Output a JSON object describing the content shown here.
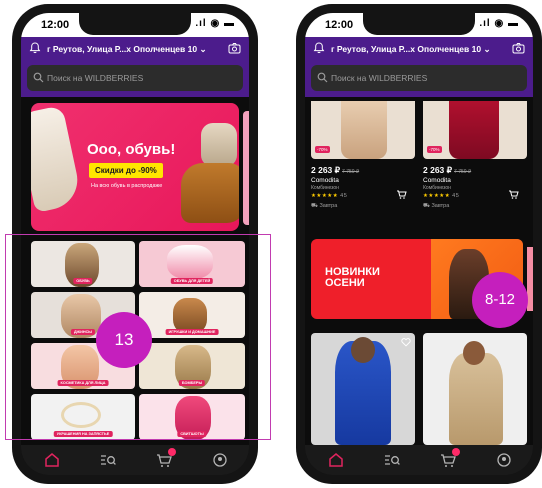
{
  "status": {
    "time": "12:00"
  },
  "header": {
    "address": "г Реутов, Улица Р...х Ополченцев 10"
  },
  "search": {
    "placeholder": "Поиск на WILDBERRIES"
  },
  "banner_shoes": {
    "title": "Ооо, обувь!",
    "badge": "Скидки до -90%",
    "subtitle": "На всю обувь в распродаже"
  },
  "categories": [
    {
      "label": "ОБУВЬ"
    },
    {
      "label": "ОБУВЬ ДЛЯ ДЕТЕЙ"
    },
    {
      "label": "ДЖИНСЫ"
    },
    {
      "label": "ИГРУШКИ И ДОМАШНИЕ"
    },
    {
      "label": "КОСМЕТИКА ДЛЯ ЛИЦА"
    },
    {
      "label": "БОМБЕРЫ"
    },
    {
      "label": "УКРАШЕНИЯ НА ЗАПЯСТЬЕ"
    },
    {
      "label": "СВИТШОТЫ"
    }
  ],
  "products": [
    {
      "price": "2 263 ₽",
      "old_price": "7 750 ₽",
      "discount": "-70%",
      "brand": "Comodita",
      "kind": "Комбинезон",
      "stars": "★★★★★",
      "reviews": "45",
      "delivery": "Завтра"
    },
    {
      "price": "2 263 ₽",
      "old_price": "7 750 ₽",
      "discount": "-70%",
      "brand": "Comodita",
      "kind": "Комбинезон",
      "stars": "★★★★★",
      "reviews": "45",
      "delivery": "Завтра"
    }
  ],
  "banner_autumn": {
    "line1": "НОВИНКИ",
    "line2": "ОСЕНИ"
  },
  "annotations": {
    "left": "13",
    "right": "8-12"
  },
  "colors": {
    "brand": "#4c1c8c",
    "accent": "#e0245e",
    "annotation": "#c51fbd"
  }
}
